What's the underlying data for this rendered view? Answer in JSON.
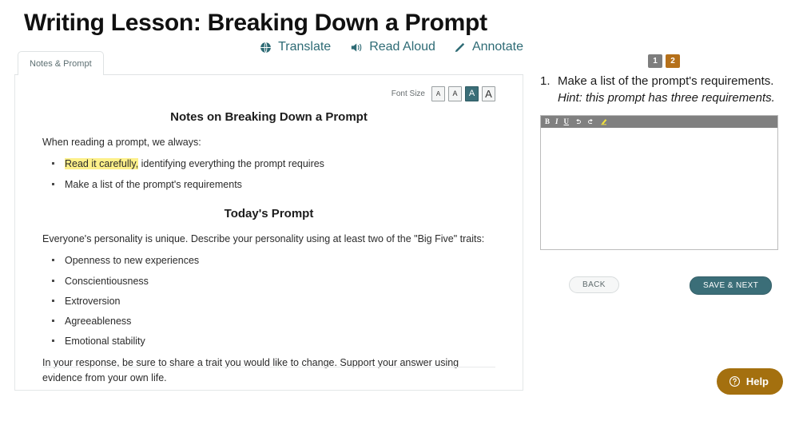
{
  "header": {
    "title": "Writing Lesson: Breaking Down a Prompt"
  },
  "left_panel": {
    "tab_label": "Notes & Prompt",
    "tools": [
      {
        "label": "Translate",
        "icon": "globe-icon"
      },
      {
        "label": "Read Aloud",
        "icon": "speaker-icon"
      },
      {
        "label": "Annotate",
        "icon": "pencil-icon"
      }
    ],
    "font_size": {
      "label": "Font Size",
      "options": [
        "A",
        "A",
        "A",
        "A"
      ],
      "selected_index": 2
    },
    "notes": {
      "heading": "Notes on Breaking Down a Prompt",
      "intro": "When reading a prompt, we always:",
      "bullet_1_highlight": "Read it carefully,",
      "bullet_1_rest": " identifying everything the prompt requires",
      "bullet_2": "Make a list of the prompt's requirements"
    },
    "prompt": {
      "heading": "Today's Prompt",
      "intro": "Everyone's personality is unique. Describe your personality using at least two of the \"Big Five\" traits:",
      "traits": [
        "Openness to new experiences",
        "Conscientiousness",
        "Extroversion",
        "Agreeableness",
        "Emotional stability"
      ],
      "closing": "In your response, be sure to share a trait you would like to change. Support your answer using evidence from your own life."
    }
  },
  "right_panel": {
    "badges": [
      {
        "label": "1",
        "state": "current"
      },
      {
        "label": "2",
        "state": "other"
      }
    ],
    "question": {
      "number": "1.",
      "text": "Make a list of the prompt's requirements. ",
      "hint": "Hint: this prompt has three requirements."
    },
    "editor": {
      "toolbar": [
        {
          "name": "bold-icon",
          "label": "B"
        },
        {
          "name": "italic-icon",
          "label": "I"
        },
        {
          "name": "underline-icon",
          "label": "U"
        },
        {
          "name": "undo-icon",
          "label": "↺"
        },
        {
          "name": "redo-icon",
          "label": "↻"
        },
        {
          "name": "highlighter-icon",
          "label": ""
        }
      ],
      "value": "",
      "placeholder": ""
    },
    "buttons": {
      "back": "BACK",
      "save_next": "SAVE & NEXT"
    }
  },
  "help": {
    "label": "Help",
    "icon": "question-circle-icon"
  },
  "colors": {
    "accent_teal": "#3b6e78",
    "badge_current": "#7d7d7d",
    "badge_other": "#b5701a",
    "help_brown": "#a4700f",
    "highlight_yellow": "#fdf08a",
    "toolbar_gray": "#808080"
  }
}
